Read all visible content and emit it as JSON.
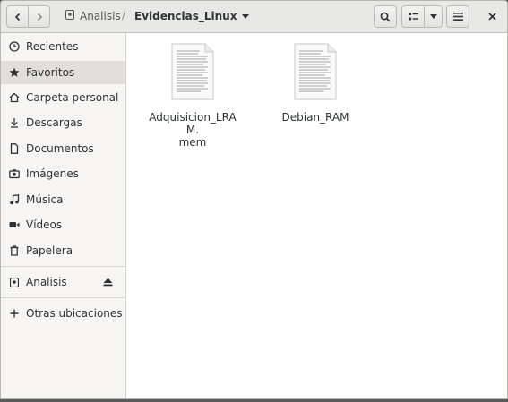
{
  "toolbar": {
    "back_icon": "chevron-left-icon",
    "forward_icon": "chevron-right-icon",
    "search_icon": "search-icon",
    "view_icon": "grid-view-icon",
    "view_menu_icon": "caret-down-icon",
    "menu_icon": "hamburger-icon",
    "close_icon": "close-icon"
  },
  "breadcrumb": {
    "root": "Analisis",
    "separator": "/",
    "current": "Evidencias_Linux"
  },
  "sidebar": {
    "items": [
      {
        "label": "Recientes",
        "icon": "clock-icon"
      },
      {
        "label": "Favoritos",
        "icon": "star-icon"
      },
      {
        "label": "Carpeta personal",
        "icon": "home-icon"
      },
      {
        "label": "Descargas",
        "icon": "download-icon"
      },
      {
        "label": "Documentos",
        "icon": "document-icon"
      },
      {
        "label": "Imágenes",
        "icon": "camera-icon"
      },
      {
        "label": "Música",
        "icon": "music-icon"
      },
      {
        "label": "Vídeos",
        "icon": "video-icon"
      },
      {
        "label": "Papelera",
        "icon": "trash-icon"
      }
    ],
    "drive": {
      "label": "Analisis",
      "icon": "drive-icon",
      "eject_icon": "eject-icon"
    },
    "other": {
      "label": "Otras ubicaciones",
      "icon": "plus-icon"
    }
  },
  "files": [
    {
      "name": "Adquisicion_LRAM.mem",
      "line1": "Adquisicion_LRAM.",
      "line2": "mem",
      "icon": "text-document-icon"
    },
    {
      "name": "Debian_RAM",
      "line1": "Debian_RAM",
      "line2": "",
      "icon": "text-document-icon"
    }
  ],
  "colors": {
    "headerbar": "#e8e8e7",
    "sidebar_bg": "#f6f5f4",
    "sidebar_active": "#e1dedb",
    "text": "#2e3436"
  }
}
